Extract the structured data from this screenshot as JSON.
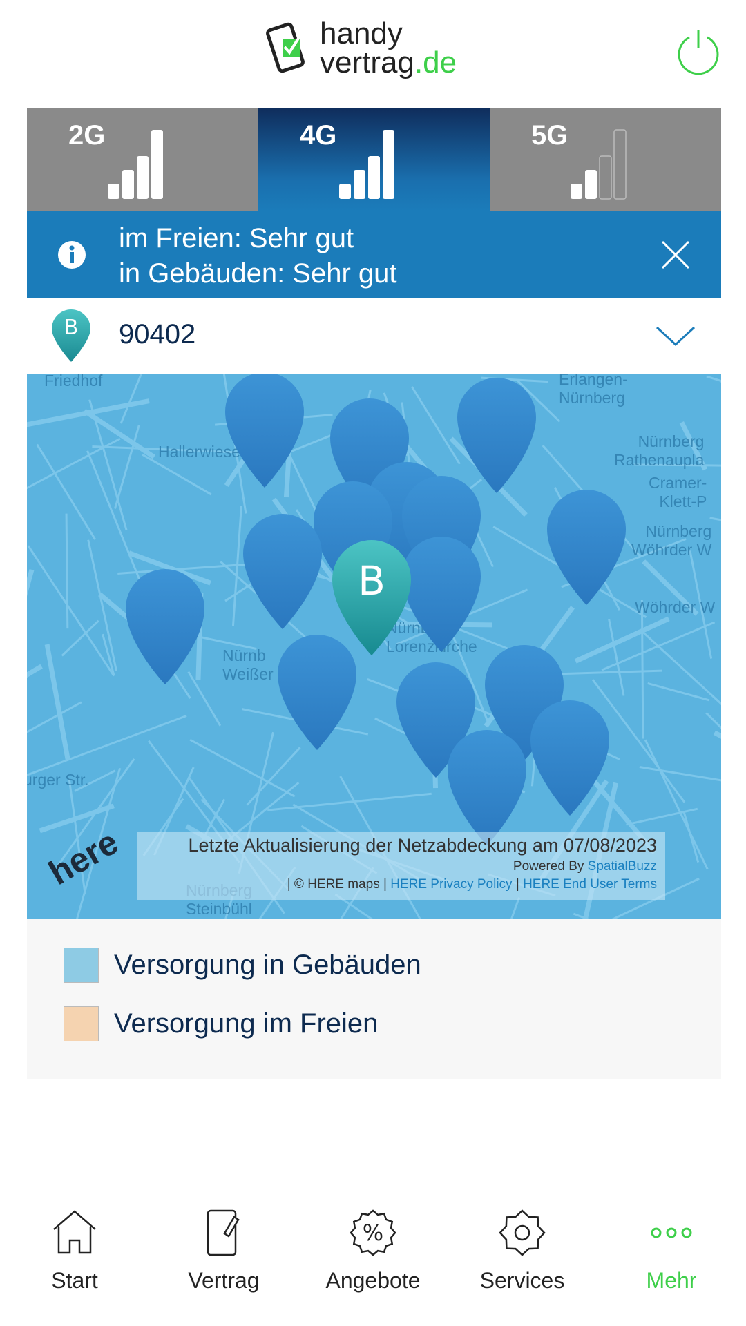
{
  "header": {
    "logo_line1": "handy",
    "logo_line2": "vertrag",
    "logo_tld": ".de",
    "power_icon": "power-icon"
  },
  "tabs": [
    {
      "label": "2G",
      "bars": 4,
      "active": false
    },
    {
      "label": "4G",
      "bars": 4,
      "active": true
    },
    {
      "label": "5G",
      "bars": 2,
      "active": false
    }
  ],
  "banner": {
    "line1": "im Freien: Sehr gut",
    "line2": "in Gebäuden: Sehr gut"
  },
  "location": {
    "marker": "B",
    "value": "90402"
  },
  "map": {
    "labels": [
      "Friedhof",
      "Hallerwiese",
      "Erlangen-\nNürnberg",
      "Nürnberg\nRathenaupla",
      "Cramer-\nKlett-P",
      "Nürnberg\nWöhrder W",
      "Wöhrder W",
      "Nürnberg\nLorenzkirche",
      "Nürnb\nWeißer",
      "urger Str.",
      "Nürnberg\nSteinbühl",
      "Nürnberg"
    ],
    "center_marker": "B",
    "attribution": {
      "update": "Letzte Aktualisierung der Netzabdeckung am 07/08/2023",
      "powered_by": "Powered By",
      "powered_link": "SpatialBuzz",
      "copyright": "| © HERE maps |",
      "privacy": "HERE Privacy Policy",
      "sep": "|",
      "terms": "HERE End User Terms"
    },
    "logo": "here"
  },
  "legend": [
    {
      "label": "Versorgung in Gebäuden",
      "color": "#8ecbe4"
    },
    {
      "label": "Versorgung im Freien",
      "color": "#f5d3b0"
    }
  ],
  "nav": [
    {
      "label": "Start",
      "icon": "home-icon"
    },
    {
      "label": "Vertrag",
      "icon": "contract-icon"
    },
    {
      "label": "Angebote",
      "icon": "percent-badge-icon"
    },
    {
      "label": "Services",
      "icon": "gear-icon"
    },
    {
      "label": "Mehr",
      "icon": "more-icon",
      "active": true
    }
  ],
  "colors": {
    "accent": "#3ecf4a",
    "blue": "#1b7cba",
    "navy": "#0d2a4f"
  }
}
